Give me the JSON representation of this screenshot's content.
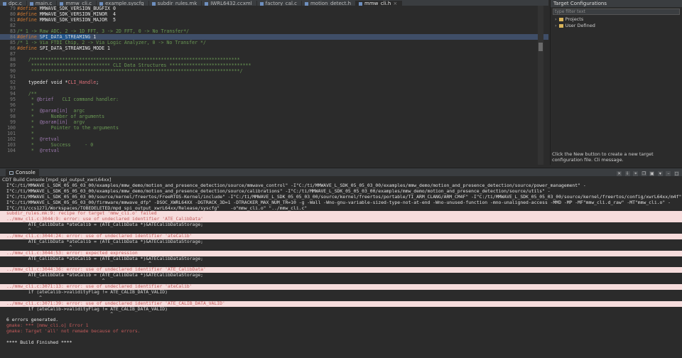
{
  "tabs": [
    {
      "label": "dpc.c",
      "active": false
    },
    {
      "label": "main.c",
      "active": false
    },
    {
      "label": "mmw_cli.c",
      "active": false
    },
    {
      "label": "example.syscfg",
      "active": false
    },
    {
      "label": "subdir_rules.mk",
      "active": false
    },
    {
      "label": "IWRL6432.ccxml",
      "active": false
    },
    {
      "label": "factory_cal.c",
      "active": false
    },
    {
      "label": "motion_detect.h",
      "active": false
    },
    {
      "label": "mmw_cli.h",
      "active": true
    }
  ],
  "editor": {
    "lines": [
      {
        "n": "79",
        "parts": [
          {
            "t": "#define",
            "c": "key"
          },
          {
            "t": " MMWAVE_SDK_VERSION_BUGFIX 0",
            "c": "def"
          }
        ]
      },
      {
        "n": "80",
        "parts": [
          {
            "t": "#define",
            "c": "key"
          },
          {
            "t": " MMWAVE_SDK_VERSION_MINOR  4",
            "c": "def"
          }
        ]
      },
      {
        "n": "81",
        "parts": [
          {
            "t": "#define",
            "c": "key"
          },
          {
            "t": " MMWAVE_SDK_VERSION_MAJOR  5",
            "c": "def"
          }
        ]
      },
      {
        "n": "82",
        "parts": []
      },
      {
        "n": "83",
        "parts": [
          {
            "t": "/* 1 -> Raw ADC, 2 -> 1D FFT, 3 -> 2D FFT, 0 -> No Transfer*/",
            "c": "com"
          }
        ]
      },
      {
        "n": "84",
        "hl": true,
        "parts": [
          {
            "t": "#define",
            "c": "key"
          },
          {
            "t": " ",
            "c": "def"
          },
          {
            "t": "SPI_DATA_STREAMING",
            "c": "sel"
          },
          {
            "t": " 1",
            "c": "def"
          }
        ]
      },
      {
        "n": "85",
        "parts": [
          {
            "t": "/* 1 -> Via FTDI Chip, 2 -> Via Logic Analyzer, 0 -> No Transfer */",
            "c": "com"
          }
        ]
      },
      {
        "n": "86",
        "parts": [
          {
            "t": "#define",
            "c": "key"
          },
          {
            "t": " SPI_DATA_STREAMING_MODE 1",
            "c": "def"
          }
        ]
      },
      {
        "n": "87",
        "parts": []
      },
      {
        "n": "88",
        "parts": [
          {
            "t": "    /**************************************************************************",
            "c": "com"
          }
        ]
      },
      {
        "n": "89",
        "parts": [
          {
            "t": "     **************************** CLI Data Structures *****************************",
            "c": "com"
          }
        ]
      },
      {
        "n": "90",
        "parts": [
          {
            "t": "     **************************************************************************/",
            "c": "com"
          }
        ]
      },
      {
        "n": "91",
        "parts": []
      },
      {
        "n": "92",
        "parts": [
          {
            "t": "    typedef void *",
            "c": "def"
          },
          {
            "t": "CLI_Handle",
            "c": "str"
          },
          {
            "t": ";",
            "c": "def"
          }
        ]
      },
      {
        "n": "93",
        "parts": []
      },
      {
        "n": "94",
        "parts": [
          {
            "t": "    /**",
            "c": "com"
          }
        ]
      },
      {
        "n": "95",
        "parts": [
          {
            "t": "     * ",
            "c": "com"
          },
          {
            "t": "@brief",
            "c": "tag"
          },
          {
            "t": "   CLI command handler:",
            "c": "com"
          }
        ]
      },
      {
        "n": "96",
        "parts": [
          {
            "t": "     *",
            "c": "com"
          }
        ]
      },
      {
        "n": "97",
        "parts": [
          {
            "t": "     *  ",
            "c": "com"
          },
          {
            "t": "@param[in]",
            "c": "tag"
          },
          {
            "t": "  argc",
            "c": "com"
          }
        ]
      },
      {
        "n": "98",
        "parts": [
          {
            "t": "     *      Number of arguments",
            "c": "com"
          }
        ]
      },
      {
        "n": "99",
        "parts": [
          {
            "t": "     *  ",
            "c": "com"
          },
          {
            "t": "@param[in]",
            "c": "tag"
          },
          {
            "t": "  argv",
            "c": "com"
          }
        ]
      },
      {
        "n": "100",
        "parts": [
          {
            "t": "     *      Pointer to the arguments",
            "c": "com"
          }
        ]
      },
      {
        "n": "101",
        "parts": [
          {
            "t": "     *",
            "c": "com"
          }
        ]
      },
      {
        "n": "102",
        "parts": [
          {
            "t": "     *  ",
            "c": "com"
          },
          {
            "t": "@retval",
            "c": "tag"
          }
        ]
      },
      {
        "n": "103",
        "parts": [
          {
            "t": "     *      Success     - 0",
            "c": "com"
          }
        ]
      },
      {
        "n": "104",
        "parts": [
          {
            "t": "     *  ",
            "c": "com"
          },
          {
            "t": "@retval",
            "c": "tag"
          }
        ]
      }
    ]
  },
  "right_panel": {
    "title": "Target Configurations",
    "filter_placeholder": "type filter text",
    "items": [
      "Projects",
      "User Defined"
    ],
    "message": "Click the New button to create a new target configuration file. Cli message."
  },
  "console": {
    "tab_label": "Console",
    "title": "CDT Build Console [mpd_spi_output_xwrL64xx]",
    "lines": [
      {
        "k": "cmd",
        "t": "I\"C:/ti/MMWAVE_L_SDK_05_05_03_00/examples/mmw_demo/motion_and_presence_detection/source/mmwave_control\" -I\"C:/ti/MMWAVE_L_SDK_05_05_03_00/examples/mmw_demo/motion_and_presence_detection/source/power_management\" -"
      },
      {
        "k": "cmd",
        "t": "I\"C:/ti/MMWAVE_L_SDK_05_05_03_00/examples/mmw_demo/motion_and_presence_detection/source/calibrations\" -I\"C:/ti/MMWAVE_L_SDK_05_05_03_00/examples/mmw_demo/motion_and_presence_detection/source/utils\" -"
      },
      {
        "k": "cmd",
        "t": "I\"C:/ti/MMWAVE_L_SDK_05_05_03_00/source/kernel/freertos/FreeRTOS-Kernel/include\" -I\"C:/ti/MMWAVE_L_SDK_05_05_03_00/source/kernel/freertos/portable/TI_ARM_CLANG/ARM_CM4F\" -I\"C:/ti/MMWAVE_L_SDK_05_05_03_00/source/kernel/freertos/config/xwrL64xx/m4f\" -"
      },
      {
        "k": "cmd",
        "t": "I\"C:/ti/MMWAVE_L_SDK_05_05_03_00/firmware/mmwave_dfp\" -DSOC_XWRL64XX -DGTRACK_3D=1 -DTRACKER_MAX_NUM_TR=10 -g -Wall -Wno-gnu-variable-sized-type-not-at-end -Wno-unused-function -mno-unaligned-access -MMD -MP -MF\"mmw_cli.d_raw\" -MT\"mmw_cli.o\" -"
      },
      {
        "k": "cmd",
        "t": "I\"C:/ti/ccs1271/Workspaces/TOBEDELETED/mpd_spi_output_xwrL64xx/Release/syscfg\"    -o\"mmw_cli.o\" \"../mmw_cli.c\""
      },
      {
        "k": "err",
        "t": "subdir_rules.mk:9: recipe for target 'mmw_cli.o' failed"
      },
      {
        "k": "err",
        "t": "../mmw_cli.c:3044:9: error: use of undeclared identifier 'ATE_CalibData'"
      },
      {
        "k": "std",
        "t": "        ATE_CalibData *ateCalib = (ATE_CalibData *)&ATECalibDataStorage;"
      },
      {
        "k": "std",
        "t": "        ^"
      },
      {
        "k": "err",
        "t": "../mmw_cli.c:3044:24: error: use of undeclared identifier 'ateCalib'"
      },
      {
        "k": "std",
        "t": "        ATE_CalibData *ateCalib = (ATE_CalibData *)&ATECalibDataStorage;"
      },
      {
        "k": "std",
        "t": "                       ^"
      },
      {
        "k": "err",
        "t": "../mmw_cli.c:3044:53: error: expected expression"
      },
      {
        "k": "std",
        "t": "        ATE_CalibData *ateCalib = (ATE_CalibData *)&ATECalibDataStorage;"
      },
      {
        "k": "std",
        "t": "                                                    ^"
      },
      {
        "k": "err",
        "t": "../mmw_cli.c:3044:36: error: use of undeclared identifier 'ATE_CalibData'"
      },
      {
        "k": "std",
        "t": "        ATE_CalibData *ateCalib = (ATE_CalibData *)&ATECalibDataStorage;"
      },
      {
        "k": "std",
        "t": "                                   ^"
      },
      {
        "k": "err",
        "t": "../mmw_cli.c:3071:13: error: use of undeclared identifier 'ateCalib'"
      },
      {
        "k": "std",
        "t": "        if (ateCalib->validityFlag != ATE_CALIB_DATA_VALID)"
      },
      {
        "k": "std",
        "t": "            ^"
      },
      {
        "k": "err",
        "t": "../mmw_cli.c:3071:39: error: use of undeclared identifier 'ATE_CALIB_DATA_VALID'"
      },
      {
        "k": "std",
        "t": "        if (ateCalib->validityFlag != ATE_CALIB_DATA_VALID)"
      },
      {
        "k": "std",
        "t": "                                      ^"
      },
      {
        "k": "white",
        "t": "6 errors generated."
      },
      {
        "k": "red",
        "t": "gmake: *** [mmw_cli.o] Error 1"
      },
      {
        "k": "red",
        "t": "gmake: Target 'all' not remade because of errors."
      },
      {
        "k": "std",
        "t": ""
      },
      {
        "k": "white",
        "t": "**** Build Finished ****"
      }
    ]
  },
  "colors": {
    "bg": "#2b2b2b",
    "error_bg": "#f6dcdc",
    "error_text": "#c25a5a",
    "comment": "#6a9955",
    "keyword": "#cc7832"
  }
}
